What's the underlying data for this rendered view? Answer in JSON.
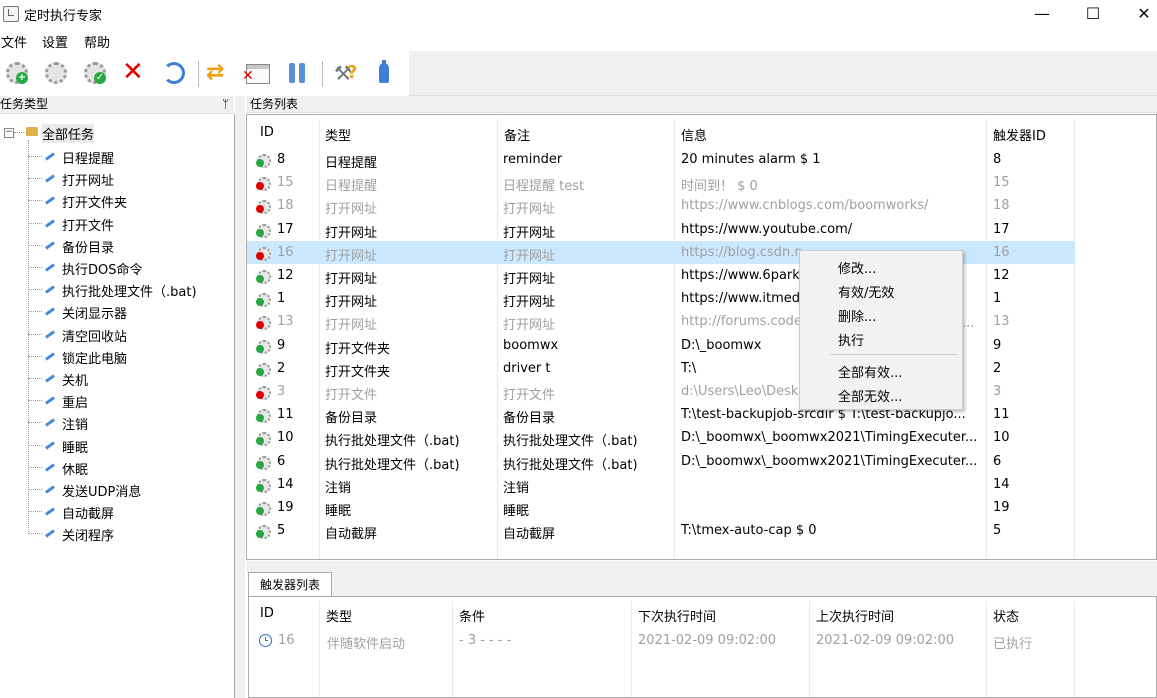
{
  "window": {
    "title": "定时执行专家",
    "minimize": "—",
    "maximize": "☐",
    "close": "✕"
  },
  "menu": [
    "文件",
    "设置",
    "帮助"
  ],
  "toolbar": {
    "icons": [
      "add-task-gear-icon",
      "edit-task-gear-icon",
      "enable-task-gear-icon",
      "delete-icon",
      "refresh-icon",
      "toggle-enable-icon",
      "stop-window-icon",
      "pause-icon",
      "tools-icon",
      "bottle-icon"
    ],
    "colors": {
      "green": "#27a844",
      "red": "#e00000",
      "blue": "#3d7fd0"
    }
  },
  "left_panel": {
    "header": "任务类型",
    "pin": "ᛘ",
    "root": {
      "toggle": "−",
      "label": "全部任务"
    },
    "items": [
      "日程提醒",
      "打开网址",
      "打开文件夹",
      "打开文件",
      "备份目录",
      "执行DOS命令",
      "执行批处理文件（.bat)",
      "关闭显示器",
      "清空回收站",
      "锁定此电脑",
      "关机",
      "重启",
      "注销",
      "睡眠",
      "休眠",
      "发送UDP消息",
      "自动截屏",
      "关闭程序"
    ]
  },
  "task_list": {
    "header": "任务列表",
    "columns": {
      "id": "ID",
      "type": "类型",
      "note": "备注",
      "info": "信息",
      "trigger": "触发器ID"
    },
    "rows": [
      {
        "id": "8",
        "type": "日程提醒",
        "note": "reminder",
        "info": "20 minutes alarm $ 1",
        "trigger": "8",
        "enabled": true,
        "selected": false
      },
      {
        "id": "15",
        "type": "日程提醒",
        "note": "日程提醒 test",
        "info": "时间到！ $ 0",
        "trigger": "15",
        "enabled": false,
        "selected": false
      },
      {
        "id": "18",
        "type": "打开网址",
        "note": "打开网址",
        "info": "https://www.cnblogs.com/boomworks/",
        "trigger": "18",
        "enabled": false,
        "selected": false
      },
      {
        "id": "17",
        "type": "打开网址",
        "note": "打开网址",
        "info": "https://www.youtube.com/",
        "trigger": "17",
        "enabled": true,
        "selected": false
      },
      {
        "id": "16",
        "type": "打开网址",
        "note": "打开网址",
        "info": "https://blog.csdn.n",
        "trigger": "16",
        "enabled": false,
        "selected": true
      },
      {
        "id": "12",
        "type": "打开网址",
        "note": "打开网址",
        "info": "https://www.6park",
        "trigger": "12",
        "enabled": true,
        "selected": false
      },
      {
        "id": "1",
        "type": "打开网址",
        "note": "打开网址",
        "info": "https://www.itmed",
        "trigger": "1",
        "enabled": true,
        "selected": false
      },
      {
        "id": "13",
        "type": "打开网址",
        "note": "打开网址",
        "info": "http://forums.code",
        "trigger": "13",
        "enabled": false,
        "selected": false
      },
      {
        "id": "9",
        "type": "打开文件夹",
        "note": "boomwx",
        "info": "D:\\_boomwx",
        "trigger": "9",
        "enabled": true,
        "selected": false
      },
      {
        "id": "2",
        "type": "打开文件夹",
        "note": "driver t",
        "info": "T:\\",
        "trigger": "2",
        "enabled": true,
        "selected": false
      },
      {
        "id": "3",
        "type": "打开文件",
        "note": "打开文件",
        "info": "d:\\Users\\Leo\\Desk",
        "trigger": "3",
        "enabled": false,
        "selected": false
      },
      {
        "id": "11",
        "type": "备份目录",
        "note": "备份目录",
        "info": "T:\\test-backupjob-srcdir $ T:\\test-backupjo...",
        "trigger": "11",
        "enabled": true,
        "selected": false
      },
      {
        "id": "10",
        "type": "执行批处理文件（.bat)",
        "note": "执行批处理文件（.bat)",
        "info": "D:\\_boomwx\\_boomwx2021\\TimingExecuter...",
        "trigger": "10",
        "enabled": true,
        "selected": false
      },
      {
        "id": "6",
        "type": "执行批处理文件（.bat)",
        "note": "执行批处理文件（.bat)",
        "info": "D:\\_boomwx\\_boomwx2021\\TimingExecuter...",
        "trigger": "6",
        "enabled": true,
        "selected": false
      },
      {
        "id": "14",
        "type": "注销",
        "note": "注销",
        "info": "",
        "trigger": "14",
        "enabled": true,
        "selected": false
      },
      {
        "id": "19",
        "type": "睡眠",
        "note": "睡眠",
        "info": "",
        "trigger": "19",
        "enabled": true,
        "selected": false
      },
      {
        "id": "5",
        "type": "自动截屏",
        "note": "自动截屏",
        "info": "T:\\tmex-auto-cap $ 0",
        "trigger": "5",
        "enabled": true,
        "selected": false
      }
    ]
  },
  "context_menu": {
    "items": [
      "修改...",
      "有效/无效",
      "删除...",
      "执行",
      "全部有效...",
      "全部无效..."
    ],
    "overflow_hint": "..."
  },
  "trigger_list": {
    "tab": "触发器列表",
    "columns": {
      "id": "ID",
      "type": "类型",
      "cond": "条件",
      "next": "下次执行时间",
      "last": "上次执行时间",
      "status": "状态"
    },
    "rows": [
      {
        "id": "16",
        "type": "伴随软件启动",
        "cond": "- 3 - - - -",
        "next": "2021-02-09 09:02:00",
        "last": "2021-02-09 09:02:00",
        "status": "已执行"
      }
    ]
  }
}
